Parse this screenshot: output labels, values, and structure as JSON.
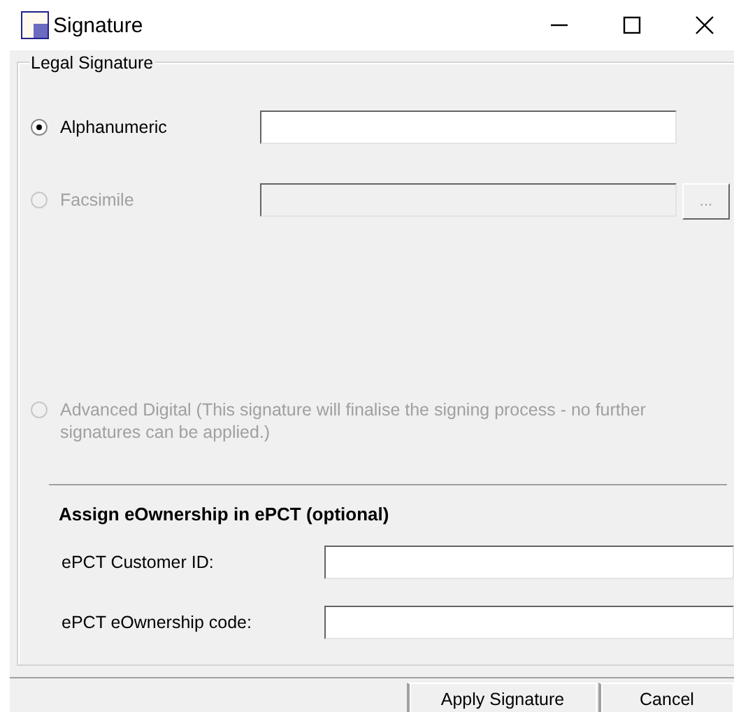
{
  "window": {
    "title": "Signature"
  },
  "legal_signature": {
    "title": "Legal Signature",
    "options": [
      {
        "kind": "text",
        "label": "Alphanumeric",
        "selected": true,
        "disabled": false
      },
      {
        "kind": "file",
        "label": "Facsimile",
        "selected": false,
        "disabled": true,
        "browse_button": "..."
      },
      {
        "kind": "plain",
        "label": "Advanced Digital (This signature will finalise the signing process - no further signatures can be applied.)",
        "selected": false,
        "disabled": true
      }
    ]
  },
  "eownership": {
    "heading": "Assign eOwnership in ePCT (optional)",
    "fields": [
      {
        "label": "ePCT Customer ID:"
      },
      {
        "label": "ePCT eOwnership code:"
      }
    ]
  },
  "buttons": [
    {
      "label": "Apply Signature"
    },
    {
      "label": "Cancel"
    }
  ]
}
